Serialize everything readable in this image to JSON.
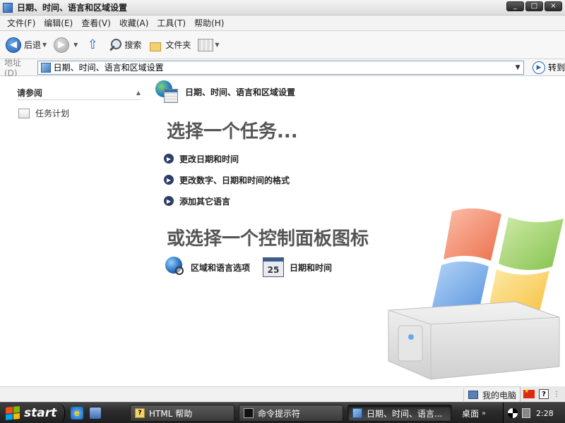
{
  "window": {
    "title": "日期、时间、语言和区域设置",
    "controls": {
      "minimize": "_",
      "maximize": "□",
      "close": "×"
    }
  },
  "menubar": {
    "items": [
      "文件(F)",
      "编辑(E)",
      "查看(V)",
      "收藏(A)",
      "工具(T)",
      "帮助(H)"
    ]
  },
  "toolbar": {
    "back_label": "后退",
    "search_label": "搜索",
    "folders_label": "文件夹",
    "icons": {
      "back": "back-arrow-icon",
      "forward": "forward-arrow-icon",
      "up": "up-folder-icon",
      "search": "search-icon",
      "folders": "folders-icon",
      "views": "views-icon"
    }
  },
  "addressbar": {
    "label": "地址(D)",
    "value": "日期、时间、语言和区域设置",
    "go_label": "转到"
  },
  "left_pane": {
    "see_also_header": "请参阅",
    "links": [
      {
        "label": "任务计划",
        "icon": "scheduled-tasks-icon"
      }
    ]
  },
  "main": {
    "category_title": "日期、时间、语言和区域设置",
    "task_heading": "选择一个任务...",
    "tasks": [
      {
        "label": "更改日期和时间"
      },
      {
        "label": "更改数字、日期和时间的格式"
      },
      {
        "label": "添加其它语言"
      }
    ],
    "icon_heading": "或选择一个控制面板图标",
    "cp_icons": [
      {
        "label": "区域和语言选项",
        "icon": "region-language-icon"
      },
      {
        "label": "日期和时间",
        "icon": "date-time-icon",
        "icon_text": "25"
      }
    ]
  },
  "statusbar": {
    "zone_label": "我的电脑"
  },
  "language_bar": {
    "flag": "china-flag-icon",
    "help": "?"
  },
  "taskbar": {
    "start_label": "start",
    "buttons": [
      {
        "label": "HTML 帮助",
        "icon": "help-file-icon"
      },
      {
        "label": "命令提示符",
        "icon": "command-prompt-icon"
      },
      {
        "label": "日期、时间、语言...",
        "icon": "control-panel-icon",
        "active": true
      }
    ],
    "desktop_label": "桌面",
    "clock": "2:28"
  },
  "colors": {
    "taskbar": "#2c2c2c",
    "heading_gray": "#555555",
    "bullet": "#2b3e66",
    "accent_blue": "#2a64b8"
  }
}
